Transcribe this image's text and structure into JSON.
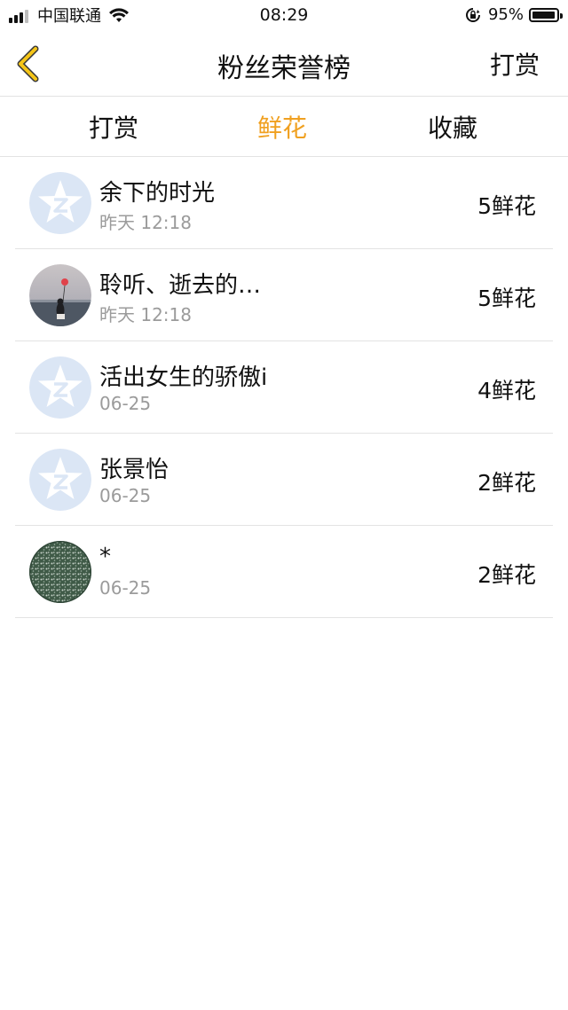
{
  "status_bar": {
    "carrier": "中国联通",
    "time": "08:29",
    "battery": "95%",
    "battery_fraction": 0.95
  },
  "nav": {
    "back_icon": "chevron-left-icon",
    "title": "粉丝荣誉榜",
    "action_label": "打赏"
  },
  "tabs": [
    {
      "label": "打赏",
      "active": false
    },
    {
      "label": "鲜花",
      "active": true
    },
    {
      "label": "收藏",
      "active": false
    }
  ],
  "colors": {
    "accent": "#f0a020",
    "back_icon": "#f5c518",
    "default_avatar": "#dbe6f5"
  },
  "rows": [
    {
      "name": "余下的时光",
      "time": "昨天 12:18",
      "amount": "5鲜花",
      "avatar": "qzone-default-avatar"
    },
    {
      "name": "聆听、逝去的…",
      "time": "昨天 12:18",
      "amount": "5鲜花",
      "avatar": "photo-avatar-girl-balloon"
    },
    {
      "name": "活出女生的骄傲i",
      "time": "06-25",
      "amount": "4鲜花",
      "avatar": "qzone-default-avatar"
    },
    {
      "name": "张景怡",
      "time": "06-25",
      "amount": "2鲜花",
      "avatar": "qzone-default-avatar"
    },
    {
      "name": "*",
      "time": "06-25",
      "amount": "2鲜花",
      "avatar": "photo-avatar-green-pattern"
    }
  ]
}
